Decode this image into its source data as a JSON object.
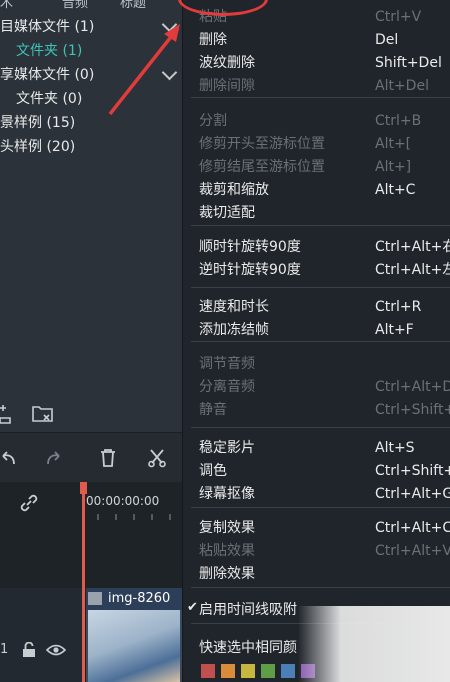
{
  "top_tabs": [
    "木",
    "音频",
    "标题"
  ],
  "media_tree": [
    {
      "label": "目媒体文件 (1)",
      "child": false,
      "selected": false,
      "chevron": true
    },
    {
      "label": "文件夹 (1)",
      "child": true,
      "selected": true,
      "chevron": false
    },
    {
      "label": "享媒体文件 (0)",
      "child": false,
      "selected": false,
      "chevron": true
    },
    {
      "label": "文件夹 (0)",
      "child": true,
      "selected": false,
      "chevron": false
    },
    {
      "label": "景样例 (15)",
      "child": false,
      "selected": false,
      "chevron": false
    },
    {
      "label": "头样例 (20)",
      "child": false,
      "selected": false,
      "chevron": false
    }
  ],
  "timeline": {
    "timecode": "00:00:00:00",
    "clip_name": "img-8260",
    "track_number": "1"
  },
  "context_menu": {
    "items": [
      {
        "label": "粘贴",
        "shortcut": "Ctrl+V",
        "enabled": false
      },
      {
        "label": "删除",
        "shortcut": "Del",
        "enabled": true
      },
      {
        "label": "波纹删除",
        "shortcut": "Shift+Del",
        "enabled": true
      },
      {
        "label": "删除间隙",
        "shortcut": "Alt+Del",
        "enabled": false
      },
      {
        "label": "分割",
        "shortcut": "Ctrl+B",
        "enabled": false
      },
      {
        "label": "修剪开头至游标位置",
        "shortcut": "Alt+[",
        "enabled": false
      },
      {
        "label": "修剪结尾至游标位置",
        "shortcut": "Alt+]",
        "enabled": false
      },
      {
        "label": "裁剪和缩放",
        "shortcut": "Alt+C",
        "enabled": true
      },
      {
        "label": "裁切适配",
        "shortcut": "",
        "enabled": true
      },
      {
        "label": "顺时针旋转90度",
        "shortcut": "Ctrl+Alt+右",
        "enabled": true
      },
      {
        "label": "逆时针旋转90度",
        "shortcut": "Ctrl+Alt+左",
        "enabled": true
      },
      {
        "label": "速度和时长",
        "shortcut": "Ctrl+R",
        "enabled": true
      },
      {
        "label": "添加冻结帧",
        "shortcut": "Alt+F",
        "enabled": true
      },
      {
        "label": "调节音频",
        "shortcut": "",
        "enabled": false
      },
      {
        "label": "分离音频",
        "shortcut": "Ctrl+Alt+D",
        "enabled": false
      },
      {
        "label": "静音",
        "shortcut": "Ctrl+Shift+",
        "enabled": false
      },
      {
        "label": "稳定影片",
        "shortcut": "Alt+S",
        "enabled": true
      },
      {
        "label": "调色",
        "shortcut": "Ctrl+Shift+",
        "enabled": true
      },
      {
        "label": "绿幕抠像",
        "shortcut": "Ctrl+Alt+G",
        "enabled": true
      },
      {
        "label": "复制效果",
        "shortcut": "Ctrl+Alt+C",
        "enabled": true
      },
      {
        "label": "粘贴效果",
        "shortcut": "Ctrl+Alt+V",
        "enabled": false
      },
      {
        "label": "删除效果",
        "shortcut": "",
        "enabled": true
      },
      {
        "label": "启用时间线吸附",
        "shortcut": "",
        "enabled": true,
        "checked": true
      },
      {
        "label": "快速选中相同颜",
        "shortcut": "",
        "enabled": true
      }
    ]
  },
  "color_swatches": [
    "#c0504d",
    "#d98c3a",
    "#c7b740",
    "#5f9e46",
    "#4a7fb8",
    "#8a5ab0"
  ],
  "colors": {
    "accent": "#3fc3b7",
    "highlight_red": "#e23b3b",
    "playhead": "#e05b4b"
  }
}
